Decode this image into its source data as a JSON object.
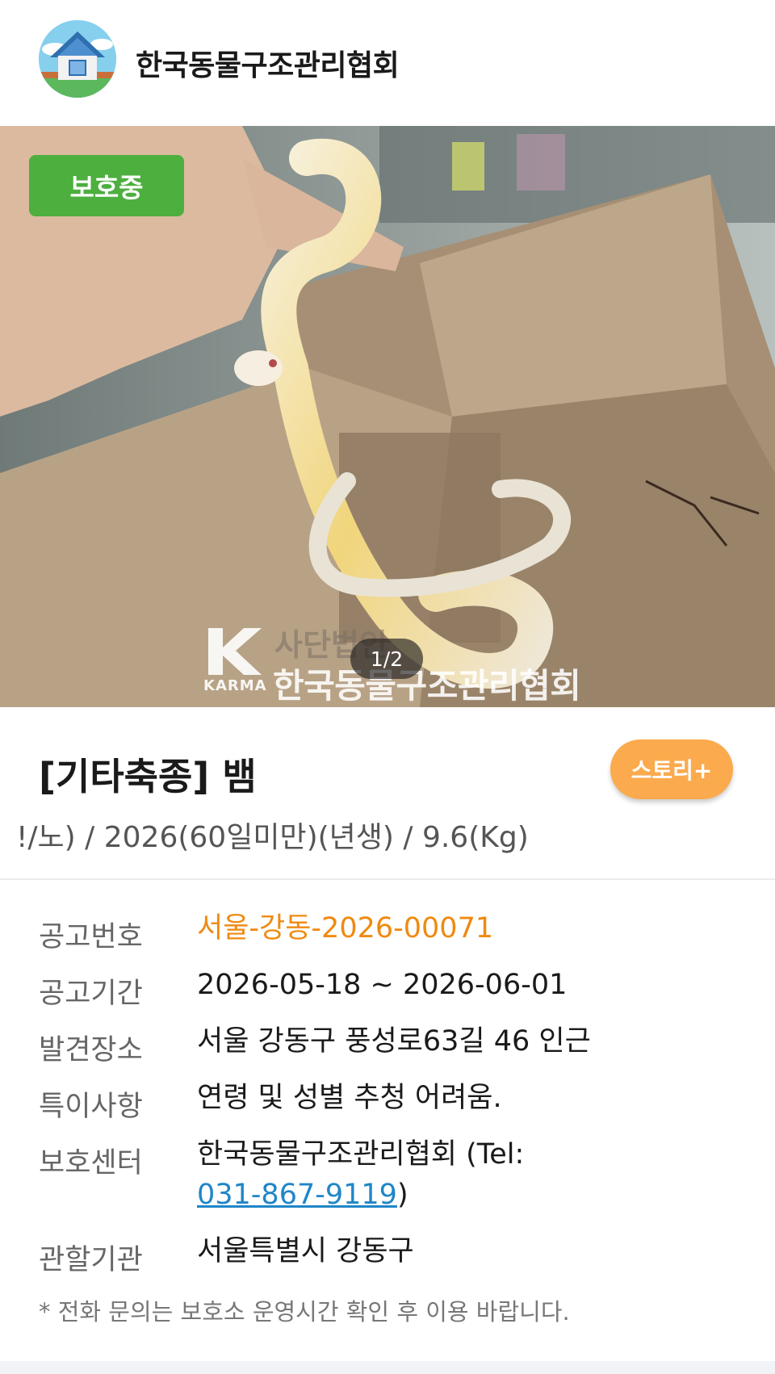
{
  "header": {
    "org_name": "한국동물구조관리협회",
    "logo_icon": "house-logo-icon"
  },
  "photo": {
    "status_badge": "보호중",
    "pager": "1/2",
    "watermark": {
      "logo_text": "KARMA",
      "subtitle": "사단법인",
      "title": "한국동물구조관리협회"
    }
  },
  "animal": {
    "title": "[기타축종] 뱀",
    "story_button": "스토리+",
    "subtitle": "!/노) / 2026(60일미만)(년생) / 9.6(Kg)"
  },
  "info": {
    "notice_no": {
      "label": "공고번호",
      "value": "서울-강동-2026-00071"
    },
    "notice_period": {
      "label": "공고기간",
      "value": "2026-05-18 ~ 2026-06-01"
    },
    "found_place": {
      "label": "발견장소",
      "value": "서울 강동구 풍성로63길 46 인근"
    },
    "remarks": {
      "label": "특이사항",
      "value": "연령 및 성별 추청 어려움."
    },
    "shelter": {
      "label": "보호센터",
      "value_prefix": "한국동물구조관리협회 (Tel:",
      "phone": "031-867-9119",
      "value_suffix": ")"
    },
    "authority": {
      "label": "관할기관",
      "value": "서울특별시 강동구"
    },
    "note": "* 전화 문의는 보호소 운영시간 확인 후 이용 바랍니다."
  },
  "colors": {
    "status_green": "#4caf3e",
    "story_orange": "#fbaa4d",
    "notice_orange": "#ef8a10",
    "link_blue": "#1f86c8"
  }
}
